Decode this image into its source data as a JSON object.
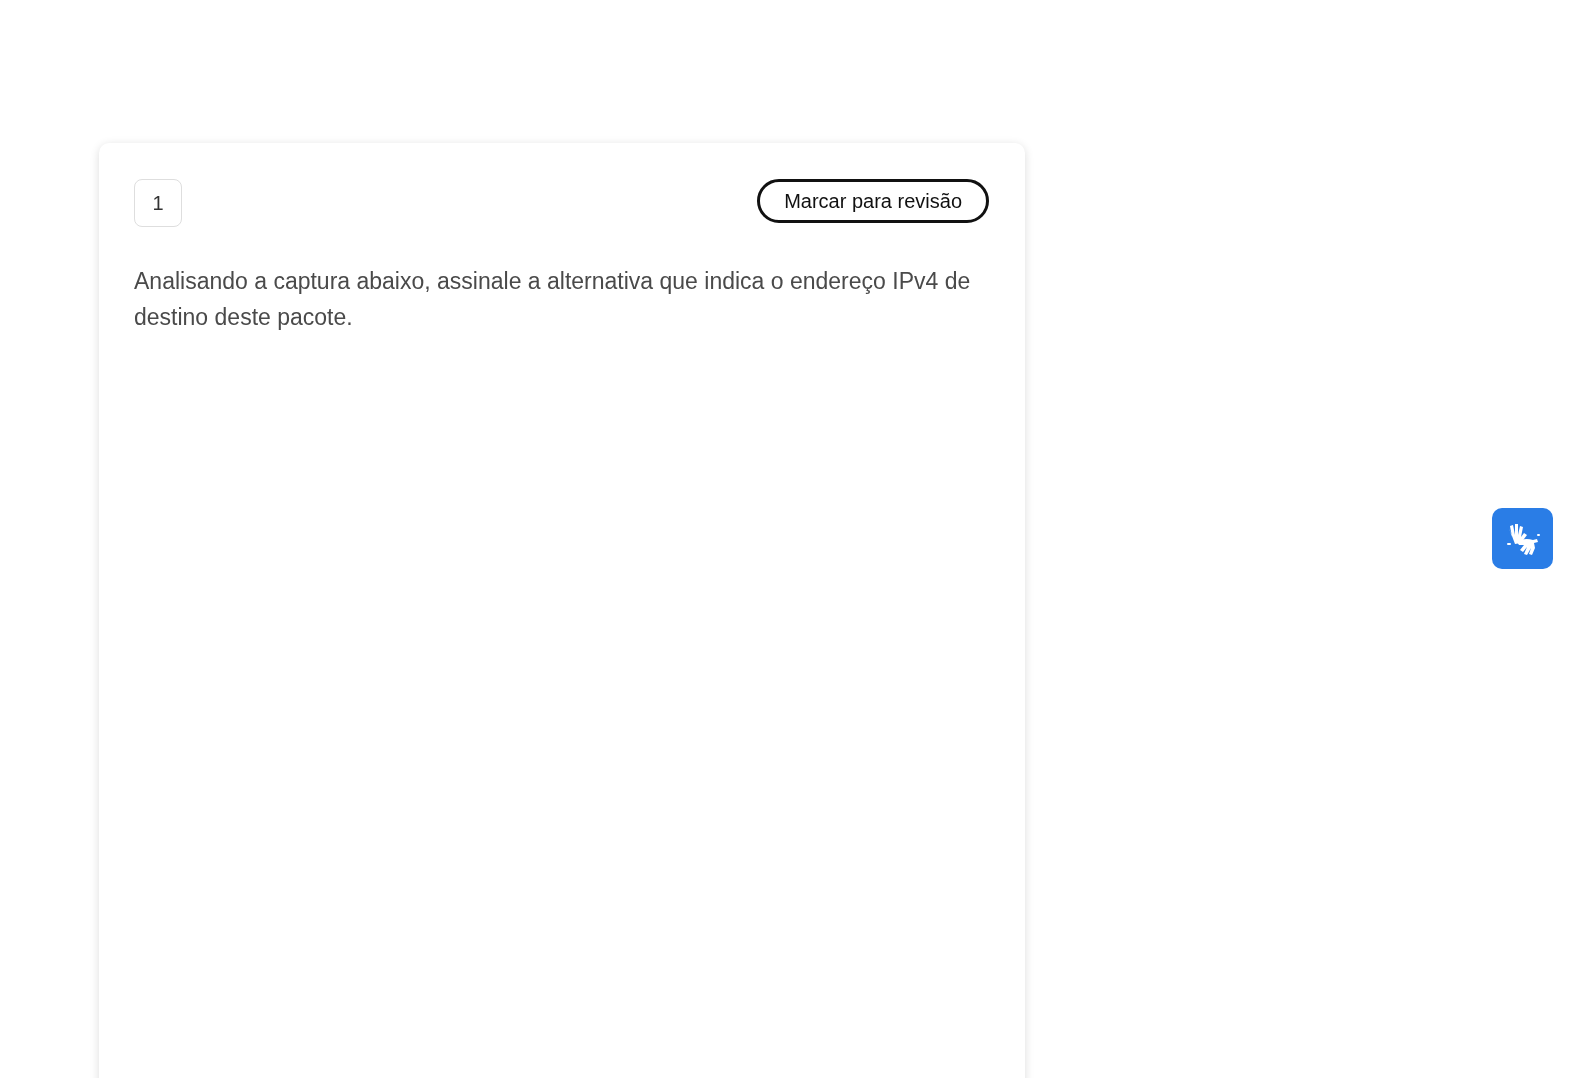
{
  "question": {
    "number": "1",
    "review_button": "Marcar para revisão",
    "text": "Analisando a captura abaixo, assinale a alternativa que indica o endereço IPv4 de destino deste pacote."
  }
}
